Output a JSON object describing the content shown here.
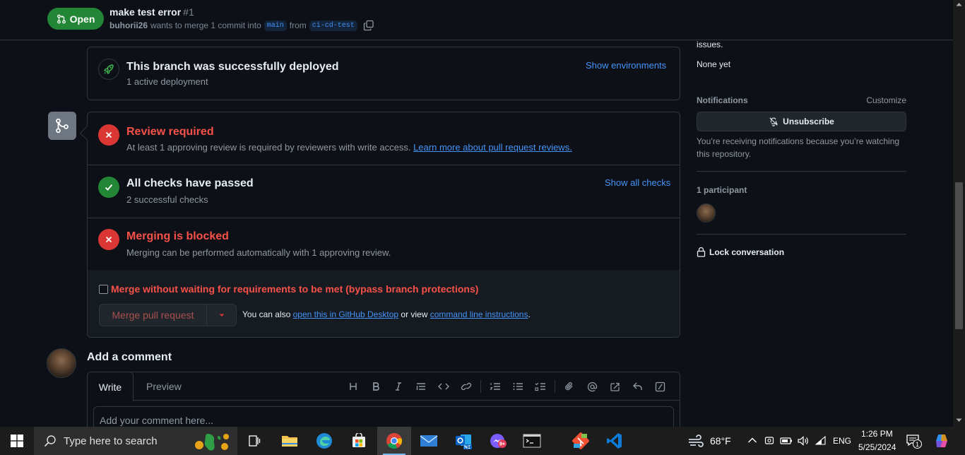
{
  "header": {
    "status": "Open",
    "title": "make test error",
    "number": "#1",
    "author": "buhorii26",
    "merge_text": "wants to merge 1 commit into",
    "base_branch": "main",
    "from_text": "from",
    "head_branch": "ci-cd-test"
  },
  "deploy": {
    "title": "This branch was successfully deployed",
    "subtitle": "1 active deployment",
    "action": "Show environments"
  },
  "review": {
    "title": "Review required",
    "text": "At least 1 approving review is required by reviewers with write access.",
    "link": "Learn more about pull request reviews."
  },
  "checks": {
    "title": "All checks have passed",
    "subtitle": "2 successful checks",
    "action": "Show all checks"
  },
  "blocked": {
    "title": "Merging is blocked",
    "text": "Merging can be performed automatically with 1 approving review."
  },
  "merge": {
    "bypass_label": "Merge without waiting for requirements to be met (bypass branch protections)",
    "button": "Merge pull request",
    "also_prefix": "You can also",
    "desktop_link": "open this in GitHub Desktop",
    "or_view": "or view",
    "cli_link": "command line instructions",
    "period": "."
  },
  "comment": {
    "heading": "Add a comment",
    "tab_write": "Write",
    "tab_preview": "Preview",
    "placeholder": "Add your comment here..."
  },
  "sidebar": {
    "issues_tail": "issues.",
    "none_yet": "None yet",
    "notifications_heading": "Notifications",
    "customize": "Customize",
    "unsubscribe": "Unsubscribe",
    "notif_text_1": "You’re receiving notifications because you’re watching",
    "notif_text_2": "this repository.",
    "participants": "1 participant",
    "lock": "Lock conversation"
  },
  "taskbar": {
    "search_placeholder": "Type here to search",
    "weather": "68°F",
    "lang": "ENG",
    "time": "1:26 PM",
    "date": "5/25/2024",
    "notif_count": "1"
  },
  "colors": {
    "open_green": "#238636",
    "danger": "#f85149",
    "link": "#4493f8",
    "background": "#0d1117"
  }
}
